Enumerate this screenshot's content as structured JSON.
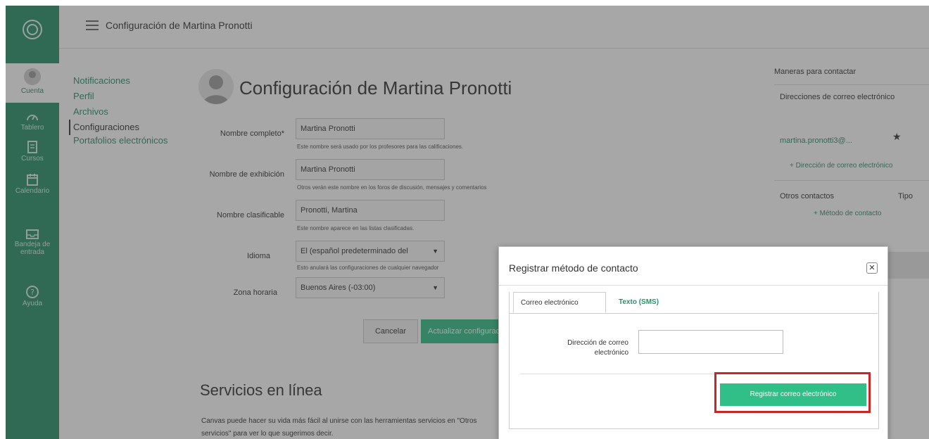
{
  "global_nav": {
    "items": [
      {
        "label": "Cuenta"
      },
      {
        "label": "Tablero"
      },
      {
        "label": "Cursos"
      },
      {
        "label": "Calendario"
      },
      {
        "label": "Bandeja de entrada"
      },
      {
        "label": "Ayuda"
      }
    ]
  },
  "header": {
    "breadcrumb": "Configuración de Martina Pronotti"
  },
  "subnav": {
    "items": [
      {
        "label": "Notificaciones"
      },
      {
        "label": "Perfil"
      },
      {
        "label": "Archivos"
      },
      {
        "label": "Configuraciones"
      },
      {
        "label": "Portafolios electrónicos"
      }
    ]
  },
  "profile": {
    "title": "Configuración de Martina Pronotti"
  },
  "form": {
    "full_name": {
      "label": "Nombre completo*",
      "value": "Martina Pronotti",
      "hint": "Este nombre será usado por los profesores para las calificaciones."
    },
    "display_name": {
      "label": "Nombre de exhibición",
      "value": "Martina Pronotti",
      "hint": "Otros verán este nombre en los foros de discusión, mensajes y comentarios"
    },
    "sortable_name": {
      "label": "Nombre clasificable",
      "value": "Pronotti, Martina",
      "hint": "Este nombre aparece en las listas clasificadas."
    },
    "language": {
      "label": "Idioma",
      "value": "El (español predeterminado del",
      "hint": "Esto anulará las configuraciones de cualquier navegador"
    },
    "timezone": {
      "label": "Zona horaria",
      "value": "Buenos Aires (-03:00)"
    },
    "cancel_label": "Cancelar",
    "update_label": "Actualizar configuraciones"
  },
  "online_services": {
    "title": "Servicios en línea",
    "desc": "Canvas puede hacer su vida más fácil al unirse con las herramientas servicios en \"Otros servicios\" para ver lo que sugerimos decir."
  },
  "right_sidebar": {
    "heading": "Maneras para contactar",
    "emails_heading": "Direcciones de correo electrónico",
    "email": "martina.pronotti3@...",
    "add_email_link": "+ Dirección de correo electrónico",
    "other_contacts": "Otros contactos",
    "type_col": "Tipo",
    "add_method_link": "+ Método de contacto"
  },
  "dialog": {
    "title": "Registrar método de contacto",
    "close_icon": "close-icon",
    "tabs": [
      {
        "label": "Correo electrónico",
        "active": true
      },
      {
        "label": "Texto (SMS)",
        "active": false
      }
    ],
    "field_label": "Dirección de correo electrónico",
    "field_value": "",
    "submit_label": "Registrar correo electrónico",
    "highlight_color": "#c62828"
  },
  "colors": {
    "brand_green": "#27906a",
    "button_green": "#2fbf87",
    "link_green": "#2a8f6a"
  }
}
